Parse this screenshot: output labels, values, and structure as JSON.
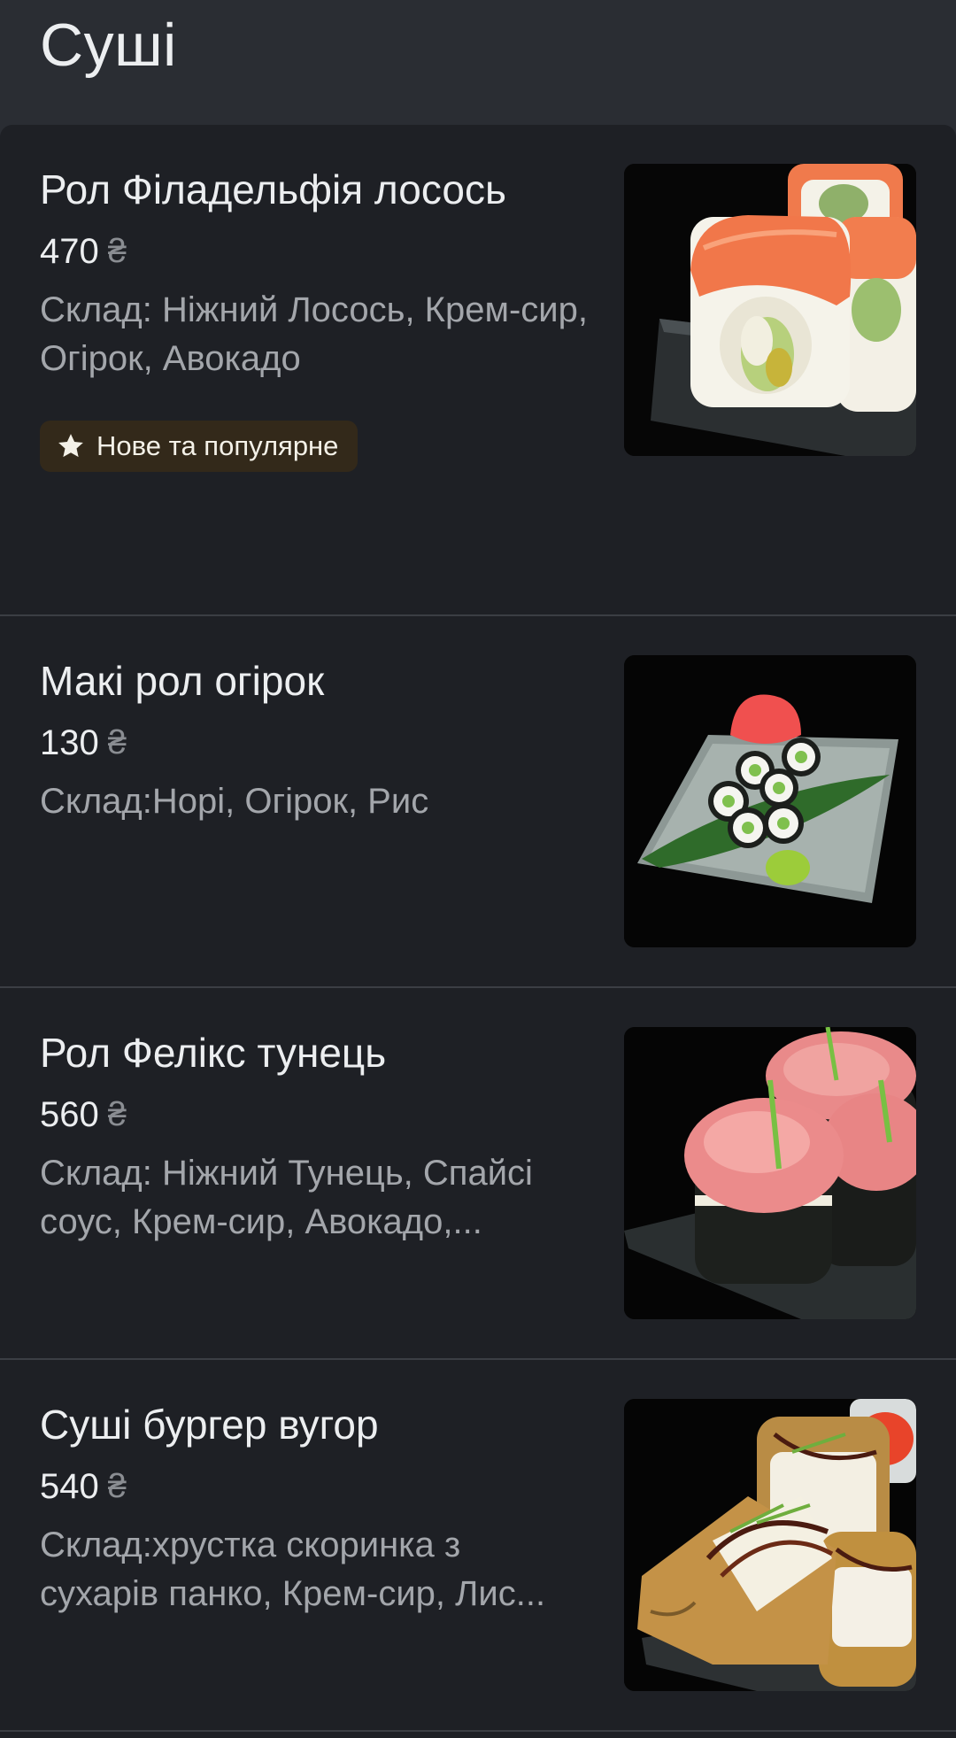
{
  "header": {
    "title": "Суші"
  },
  "currency_symbol": "₴",
  "items": [
    {
      "name": "Рол Філадельфія лосось",
      "price": "470",
      "description": "Склад: Ніжний Лосось, Крем-сир, Огірок, Авокадо",
      "badge": "Нове та популярне",
      "badge_icon": "star-icon"
    },
    {
      "name": "Макі рол огірок",
      "price": "130",
      "description": "Склад:Норі, Огірок, Рис"
    },
    {
      "name": "Рол Фелікс тунець",
      "price": "560",
      "description": "Склад: Ніжний Тунець, Спайсі соус, Крем-сир, Авокадо,..."
    },
    {
      "name": "Суші бургер вугор",
      "price": "540",
      "description": "Склад:хрустка скоринка з сухарів панко, Крем-сир, Лис..."
    }
  ],
  "colors": {
    "header_bg": "#2a2d33",
    "list_bg": "#1e2025",
    "badge_bg": "#33291a",
    "divider": "#3b3e44"
  }
}
